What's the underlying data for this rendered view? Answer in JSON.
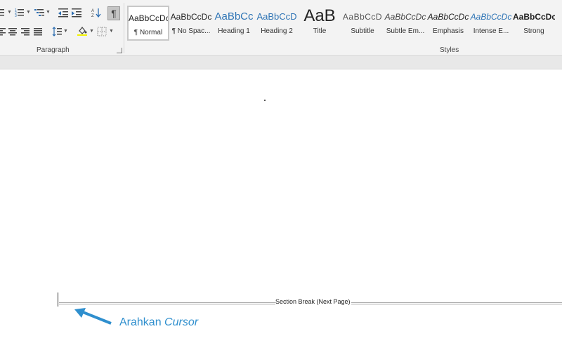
{
  "ribbon": {
    "paragraph_group_label": "Paragraph",
    "styles_group_label": "Styles",
    "styles": [
      {
        "sample": "AaBbCcDc",
        "name": "¶ Normal",
        "active": true
      },
      {
        "sample": "AaBbCcDc",
        "name": "¶ No Spac..."
      },
      {
        "sample": "AaBbCc",
        "name": "Heading 1"
      },
      {
        "sample": "AaBbCcD",
        "name": "Heading 2"
      },
      {
        "sample": "AaB",
        "name": "Title"
      },
      {
        "sample": "AaBbCcD",
        "name": "Subtitle"
      },
      {
        "sample": "AaBbCcDc",
        "name": "Subtle Em..."
      },
      {
        "sample": "AaBbCcDc",
        "name": "Emphasis"
      },
      {
        "sample": "AaBbCcDc",
        "name": "Intense E..."
      },
      {
        "sample": "AaBbCcDc",
        "name": "Strong"
      }
    ],
    "show_hide_symbol": "¶"
  },
  "document": {
    "section_break_label": "Section Break (Next Page)"
  },
  "annotation": {
    "text_plain": "Arahkan ",
    "text_italic": "Cursor",
    "color": "#2f8fce"
  }
}
